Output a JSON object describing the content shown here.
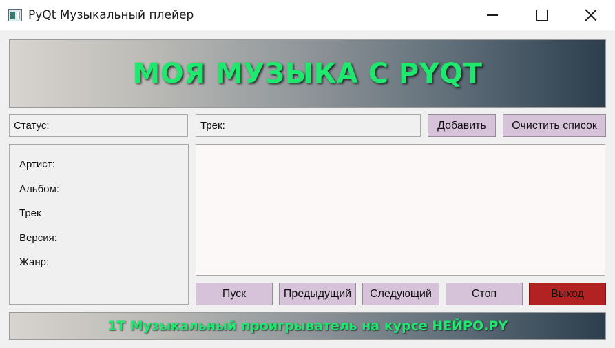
{
  "window": {
    "title": "PyQt Музыкальный плейер"
  },
  "banner": {
    "text": "МОЯ МУЗЫКА С PYQT"
  },
  "status": {
    "label": "Статус:"
  },
  "track": {
    "label": "Трек:"
  },
  "buttons": {
    "add": "Добавить",
    "clear": "Очистить список",
    "play": "Пуск",
    "prev": "Предыдущий",
    "next": "Следующий",
    "stop": "Стоп",
    "exit": "Выход"
  },
  "info": {
    "artist": "Артист:",
    "album": "Альбом:",
    "track": "Трек",
    "version": "Версия:",
    "genre": "Жанр:"
  },
  "footer": {
    "text": "1Т Музыкальный проигрыватель на курсе НЕЙРО.PY"
  },
  "colors": {
    "accent_text": "#1ee86e",
    "button": "#d6c3d9",
    "exit_button": "#b22222",
    "playlist_bg": "#fcf8f7"
  },
  "icons": {
    "app": "app-window-icon",
    "minimize": "minimize-icon",
    "maximize": "maximize-icon",
    "close": "close-icon"
  }
}
